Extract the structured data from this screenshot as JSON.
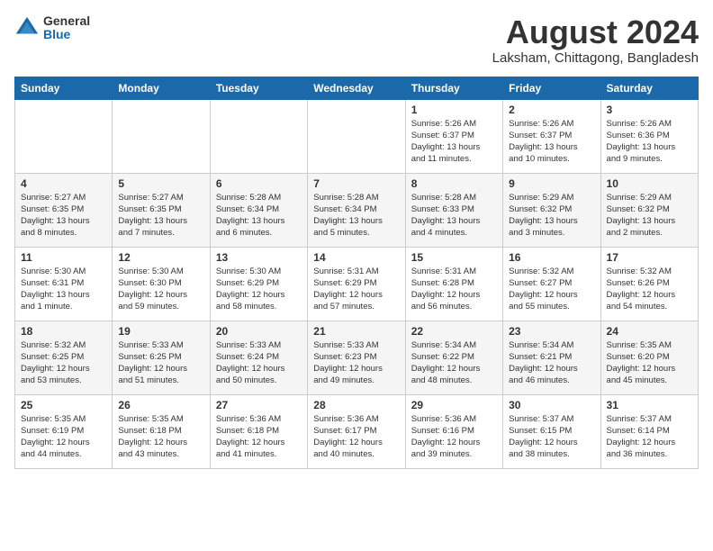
{
  "logo": {
    "general": "General",
    "blue": "Blue"
  },
  "title": "August 2024",
  "location": "Laksham, Chittagong, Bangladesh",
  "days_of_week": [
    "Sunday",
    "Monday",
    "Tuesday",
    "Wednesday",
    "Thursday",
    "Friday",
    "Saturday"
  ],
  "weeks": [
    [
      {
        "day": "",
        "info": ""
      },
      {
        "day": "",
        "info": ""
      },
      {
        "day": "",
        "info": ""
      },
      {
        "day": "",
        "info": ""
      },
      {
        "day": "1",
        "info": "Sunrise: 5:26 AM\nSunset: 6:37 PM\nDaylight: 13 hours\nand 11 minutes."
      },
      {
        "day": "2",
        "info": "Sunrise: 5:26 AM\nSunset: 6:37 PM\nDaylight: 13 hours\nand 10 minutes."
      },
      {
        "day": "3",
        "info": "Sunrise: 5:26 AM\nSunset: 6:36 PM\nDaylight: 13 hours\nand 9 minutes."
      }
    ],
    [
      {
        "day": "4",
        "info": "Sunrise: 5:27 AM\nSunset: 6:35 PM\nDaylight: 13 hours\nand 8 minutes."
      },
      {
        "day": "5",
        "info": "Sunrise: 5:27 AM\nSunset: 6:35 PM\nDaylight: 13 hours\nand 7 minutes."
      },
      {
        "day": "6",
        "info": "Sunrise: 5:28 AM\nSunset: 6:34 PM\nDaylight: 13 hours\nand 6 minutes."
      },
      {
        "day": "7",
        "info": "Sunrise: 5:28 AM\nSunset: 6:34 PM\nDaylight: 13 hours\nand 5 minutes."
      },
      {
        "day": "8",
        "info": "Sunrise: 5:28 AM\nSunset: 6:33 PM\nDaylight: 13 hours\nand 4 minutes."
      },
      {
        "day": "9",
        "info": "Sunrise: 5:29 AM\nSunset: 6:32 PM\nDaylight: 13 hours\nand 3 minutes."
      },
      {
        "day": "10",
        "info": "Sunrise: 5:29 AM\nSunset: 6:32 PM\nDaylight: 13 hours\nand 2 minutes."
      }
    ],
    [
      {
        "day": "11",
        "info": "Sunrise: 5:30 AM\nSunset: 6:31 PM\nDaylight: 13 hours\nand 1 minute."
      },
      {
        "day": "12",
        "info": "Sunrise: 5:30 AM\nSunset: 6:30 PM\nDaylight: 12 hours\nand 59 minutes."
      },
      {
        "day": "13",
        "info": "Sunrise: 5:30 AM\nSunset: 6:29 PM\nDaylight: 12 hours\nand 58 minutes."
      },
      {
        "day": "14",
        "info": "Sunrise: 5:31 AM\nSunset: 6:29 PM\nDaylight: 12 hours\nand 57 minutes."
      },
      {
        "day": "15",
        "info": "Sunrise: 5:31 AM\nSunset: 6:28 PM\nDaylight: 12 hours\nand 56 minutes."
      },
      {
        "day": "16",
        "info": "Sunrise: 5:32 AM\nSunset: 6:27 PM\nDaylight: 12 hours\nand 55 minutes."
      },
      {
        "day": "17",
        "info": "Sunrise: 5:32 AM\nSunset: 6:26 PM\nDaylight: 12 hours\nand 54 minutes."
      }
    ],
    [
      {
        "day": "18",
        "info": "Sunrise: 5:32 AM\nSunset: 6:25 PM\nDaylight: 12 hours\nand 53 minutes."
      },
      {
        "day": "19",
        "info": "Sunrise: 5:33 AM\nSunset: 6:25 PM\nDaylight: 12 hours\nand 51 minutes."
      },
      {
        "day": "20",
        "info": "Sunrise: 5:33 AM\nSunset: 6:24 PM\nDaylight: 12 hours\nand 50 minutes."
      },
      {
        "day": "21",
        "info": "Sunrise: 5:33 AM\nSunset: 6:23 PM\nDaylight: 12 hours\nand 49 minutes."
      },
      {
        "day": "22",
        "info": "Sunrise: 5:34 AM\nSunset: 6:22 PM\nDaylight: 12 hours\nand 48 minutes."
      },
      {
        "day": "23",
        "info": "Sunrise: 5:34 AM\nSunset: 6:21 PM\nDaylight: 12 hours\nand 46 minutes."
      },
      {
        "day": "24",
        "info": "Sunrise: 5:35 AM\nSunset: 6:20 PM\nDaylight: 12 hours\nand 45 minutes."
      }
    ],
    [
      {
        "day": "25",
        "info": "Sunrise: 5:35 AM\nSunset: 6:19 PM\nDaylight: 12 hours\nand 44 minutes."
      },
      {
        "day": "26",
        "info": "Sunrise: 5:35 AM\nSunset: 6:18 PM\nDaylight: 12 hours\nand 43 minutes."
      },
      {
        "day": "27",
        "info": "Sunrise: 5:36 AM\nSunset: 6:18 PM\nDaylight: 12 hours\nand 41 minutes."
      },
      {
        "day": "28",
        "info": "Sunrise: 5:36 AM\nSunset: 6:17 PM\nDaylight: 12 hours\nand 40 minutes."
      },
      {
        "day": "29",
        "info": "Sunrise: 5:36 AM\nSunset: 6:16 PM\nDaylight: 12 hours\nand 39 minutes."
      },
      {
        "day": "30",
        "info": "Sunrise: 5:37 AM\nSunset: 6:15 PM\nDaylight: 12 hours\nand 38 minutes."
      },
      {
        "day": "31",
        "info": "Sunrise: 5:37 AM\nSunset: 6:14 PM\nDaylight: 12 hours\nand 36 minutes."
      }
    ]
  ]
}
